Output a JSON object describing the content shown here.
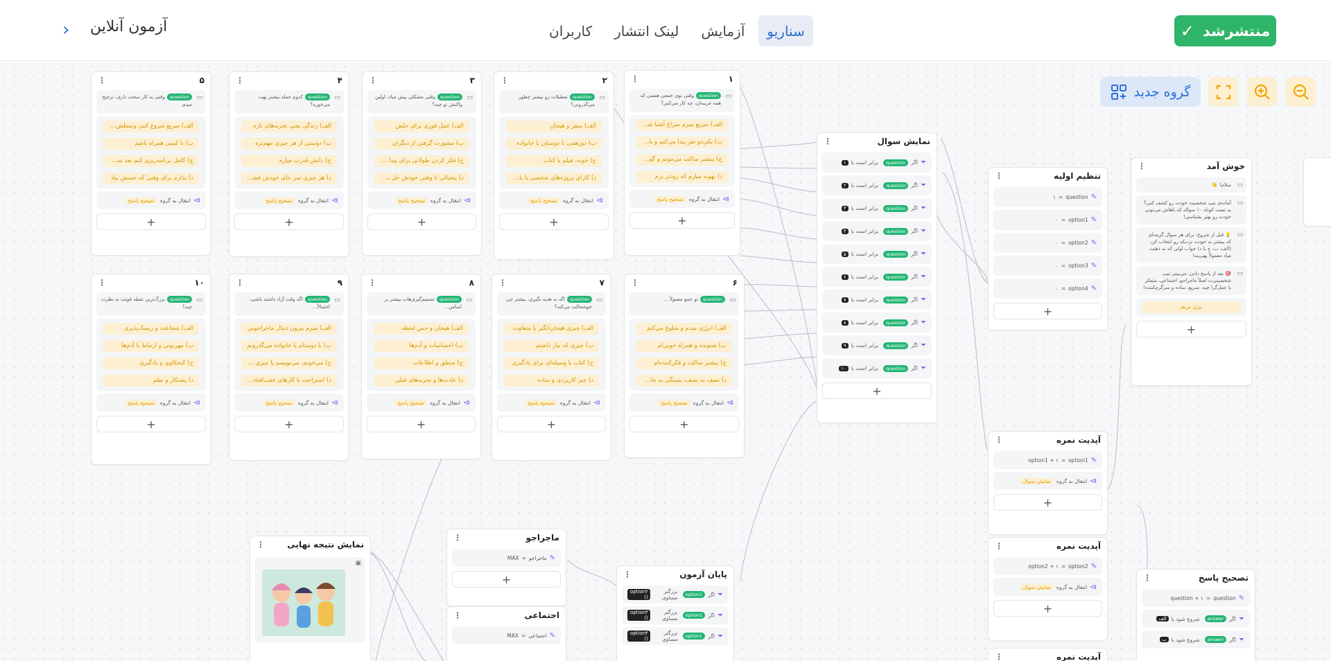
{
  "header": {
    "publish_label": "منتشرشد",
    "tabs": [
      "سناریو",
      "آزمایش",
      "لینک انتشار",
      "کاربران"
    ],
    "title": "آزمون آنلاین"
  },
  "toolbar": {
    "new_group_label": "گروه جدید"
  },
  "labels": {
    "question_badge": "question",
    "jump_to_group": "انتقال به گروه",
    "jump_target": "تصحیح پاسخ",
    "if": "اگر",
    "equals": "برابر است با",
    "greater_equal": "بزرگتر مساوی"
  },
  "question_nodes": [
    {
      "num": "۱",
      "q": "وقتی توی جمعی هستی که همه غریبه‌ان، چه کار می‌کنی؟",
      "options": [
        "الف) سریع میرم سراغ آشنا شدن ...",
        "ب) یکی‌دو نفر پیدا می‌کنم و با هم ...",
        "ج) بیشتر ساکت می‌مونم و گوش م...",
        "د) بهونه میارم که زودتر برم"
      ]
    },
    {
      "num": "۲",
      "q": "تعطیلات رو بیشتر چطور می‌گذرونی؟",
      "options": [
        "الف) سفر و هیجان",
        "ب) دورهمی با دوستان یا خانواده",
        "ج) خونه، فیلم یا کتاب",
        "د) کارای پروژه‌های شخصی یا یادگ..."
      ]
    },
    {
      "num": "۳",
      "q": "وقتی مشکلی پیش میاد، اولین واکنش تو چیه؟",
      "options": [
        "الف) عمل فوری برای حلش",
        "ب) مشورت گرفتن از دیگران",
        "ج) فکر کردن طولانی برای پیدا کرد...",
        "د) بیخیالی تا وقتی خودش حل بشه"
      ]
    },
    {
      "num": "۴",
      "q": "کدوم جمله بیشتر بهت می‌خوره؟",
      "options": [
        "الف) زندگی یعنی تجربه‌های تازه",
        "ب) دوستی از هر چیزی مهم‌تره",
        "ج) دانش قدرت میاره",
        "د) هر چیزی سر جای خودش قشنگه"
      ]
    },
    {
      "num": "۵",
      "q": "وقتی یه کار سخت داری، ترجیح میدی",
      "options": [
        "الف) سریع شروع کنم، وسطش را...",
        "ب) با کسی همراه باشم",
        "ج) کامل برنامه‌ریزی کنم بعد شرو...",
        "د) بذارم برای وقتی که حسش بیاد"
      ]
    },
    {
      "num": "۶",
      "q": "تو جمع معمولاً ...",
      "options": [
        "الف) انرژی میدم و شلوغ می‌کنم",
        "ب) شنونده و همراه خوبی‌ام",
        "ج) بیشتر ساکت و فکرکننده‌ام",
        "د) نصف به نصف، بستگی به جاش ..."
      ]
    },
    {
      "num": "۷",
      "q": "اگه یه هدیه بگیری، بیشتر چی خوشحالت می‌کنه؟",
      "options": [
        "الف) چیزی هیجان‌انگیز یا متفاوت",
        "ب) چیزی که نیاز داشتم",
        "ج) کتاب یا وسیله‌ای برای یادگیری",
        "د) چیز کاربردی و ساده"
      ]
    },
    {
      "num": "۸",
      "q": "تصمیم‌گیری‌هات بیشتر بر اساس...",
      "options": [
        "الف) هیجان و حس لحظه",
        "ب) احساسات و آدم‌ها",
        "ج) منطق و اطلاعات",
        "د) عادت‌ها و تجربه‌های قبلی"
      ]
    },
    {
      "num": "۹",
      "q": "اگه وقت آزاد داشته باشی، احتمالاً...",
      "options": [
        "الف) میرم بیرون دنبال ماجراجویی",
        "ب) با دوستام یا خانواده می‌گذرونم",
        "ج) می‌خونم، می‌نویسم یا چیزی یاد...",
        "د) استراحت یا کارهای عقب‌افتاده ..."
      ]
    },
    {
      "num": "۱۰",
      "q": "بزرگ‌ترین نقطه قوتت به نظرت چیه؟",
      "options": [
        "الف) شجاعت و ریسک‌پذیری",
        "ب) مهربونی و ارتباط با آدم‌ها",
        "ج) کنجکاوی و یادگیری",
        "د) پشتکار و نظم"
      ]
    }
  ],
  "show_question": {
    "title": "نمایش سوال",
    "rows": [
      "۱",
      "۲",
      "۳",
      "۴",
      "۵",
      "۶",
      "۷",
      "۸",
      "۹",
      "۱۰"
    ]
  },
  "initial_setup": {
    "title": "تنظیم اولیه",
    "rows": [
      {
        "var": "question",
        "val": "۱"
      },
      {
        "var": "option1",
        "val": "۰"
      },
      {
        "var": "option2",
        "val": "۰"
      },
      {
        "var": "option3",
        "val": "۰"
      },
      {
        "var": "option4",
        "val": "۰"
      }
    ]
  },
  "welcome": {
    "title": "خوش آمد",
    "texts": [
      "سلام! 👋",
      "آماده‌ی تیپ شخصیت خودت رو کشف کنی؟ یه تست کوتاه ۱۰ سواله که باهاش می‌تونی خودت رو بهتر بشناسی!",
      "💡 قبل از شروع: برای هر سوال گزینه‌ای که بیشتر به خودت نزدیکه رو انتخاب کن. (الف، ب، ج یا د) جواب اولی که به ذهنت میاد معمولاً بهترینه!",
      "🎯 بعد از پاسخ دادن، می‌بینی تیپ شخصیتی‌ت اصلاً ماجراجو، اجتماعی، متفکر یا عمل‌گرا چیه. سریع، ساده و سرگرم‌کننده!"
    ],
    "button": "بزن بریم"
  },
  "update_score_1": {
    "title": "آپدیت نمره",
    "expr": "option1 + ۱",
    "var": "option1",
    "jump_target": "نمایش سوال"
  },
  "update_score_2": {
    "title": "آپدیت نمره",
    "expr": "option2 + ۱",
    "var": "option2",
    "jump_target": "نمایش سوال"
  },
  "update_score_3": {
    "title": "آپدیت نمره"
  },
  "answer_check": {
    "title": "تصحیح پاسخ",
    "expr": "question + ۱",
    "var": "question",
    "rows": [
      {
        "badge": "answer",
        "text": "شروع شود با",
        "letter": "الف"
      },
      {
        "badge": "answer",
        "text": "شروع شود با",
        "letter": "ب"
      }
    ]
  },
  "end_quiz": {
    "title": "پایان آزمون",
    "rows": [
      {
        "badge": "option1",
        "text": "بزرگتر مساوی",
        "code": "option۲ ()"
      },
      {
        "badge": "option1",
        "text": "بزرگتر مساوی",
        "code": "option۳ ()"
      },
      {
        "badge": "option1",
        "text": "بزرگتر مساوی",
        "code": "option۴ ()"
      }
    ]
  },
  "adventurer": {
    "title": "ماجراجو",
    "fn": "MAX",
    "var": "ماجراجو"
  },
  "social": {
    "title": "اجتماعی",
    "fn": "MAX",
    "var": "اجتماعی"
  },
  "final_result": {
    "title": "نمایش نتیجه نهایی"
  }
}
